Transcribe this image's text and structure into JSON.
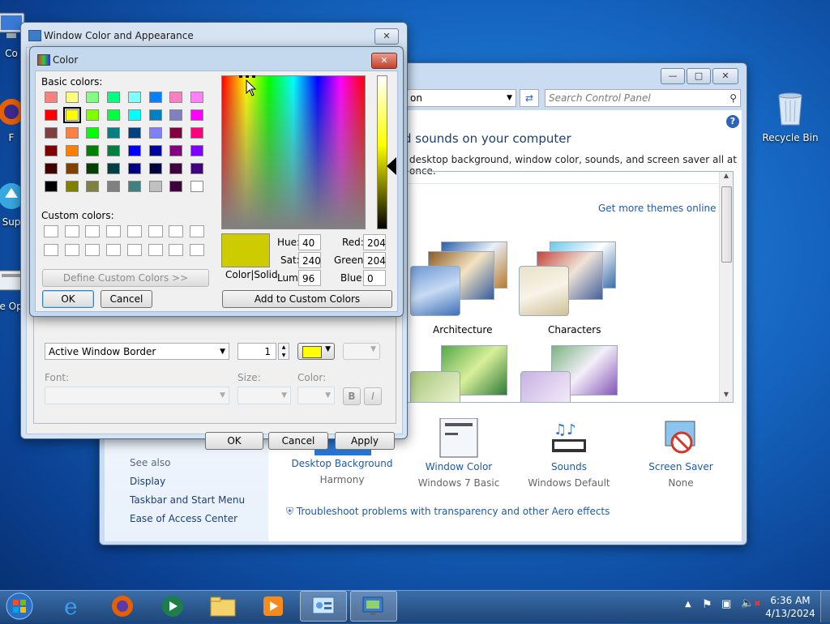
{
  "desktop": {
    "icons": [
      {
        "label": "Co",
        "icon": "computer-icon"
      },
      {
        "label": "F",
        "icon": "firefox-icon"
      },
      {
        "label": "Sup",
        "icon": "support-icon"
      },
      {
        "label": "Ke Opti",
        "icon": "keyboard-icon"
      },
      {
        "label": "Recycle Bin",
        "icon": "recycle-bin-icon"
      }
    ]
  },
  "control_panel": {
    "address_text": "on",
    "search_placeholder": "Search Control Panel",
    "heading": "d sounds on your computer",
    "subheading": "desktop background, window color, sounds, and screen saver all at once.",
    "get_more_themes": "Get more themes online",
    "themes": [
      {
        "name": "Architecture"
      },
      {
        "name": "Characters"
      }
    ],
    "bottom_items": [
      {
        "label": "Desktop Background",
        "value": "Harmony",
        "icon": "desktop-background-icon"
      },
      {
        "label": "Window Color",
        "value": "Windows 7 Basic",
        "icon": "window-color-icon"
      },
      {
        "label": "Sounds",
        "value": "Windows Default",
        "icon": "sounds-icon"
      },
      {
        "label": "Screen Saver",
        "value": "None",
        "icon": "screen-saver-icon"
      }
    ],
    "troubleshoot": "Troubleshoot problems with transparency and other Aero effects",
    "see_also": {
      "title": "See also",
      "links": [
        "Display",
        "Taskbar and Start Menu",
        "Ease of Access Center"
      ]
    }
  },
  "appearance_dialog": {
    "title": "Window Color and Appearance",
    "item_value": "Active Window Border",
    "size_value": "1",
    "color1": "#ffff00",
    "font_label": "Font:",
    "size_label": "Size:",
    "color_label": "Color:",
    "bold_label": "B",
    "italic_label": "I",
    "ok": "OK",
    "cancel": "Cancel",
    "apply": "Apply"
  },
  "color_dialog": {
    "title": "Color",
    "basic_colors_label": "Basic colors:",
    "custom_colors_label": "Custom colors:",
    "define_custom": "Define Custom Colors >>",
    "ok": "OK",
    "cancel": "Cancel",
    "add_custom": "Add to Custom Colors",
    "color_solid_label": "Color|Solid",
    "preview_color": "#cccc00",
    "hue_label": "Hue:",
    "sat_label": "Sat:",
    "lum_label": "Lum:",
    "red_label": "Red:",
    "green_label": "Green:",
    "blue_label": "Blue:",
    "hue": "40",
    "sat": "240",
    "lum": "96",
    "red": "204",
    "green": "204",
    "blue": "0",
    "basic_colors": [
      "#ff8080",
      "#ffff80",
      "#80ff80",
      "#00ff80",
      "#80ffff",
      "#0080ff",
      "#ff80c0",
      "#ff80ff",
      "#ff0000",
      "#ffff00",
      "#80ff00",
      "#00ff40",
      "#00ffff",
      "#0080c0",
      "#8080c0",
      "#ff00ff",
      "#804040",
      "#ff8040",
      "#00ff00",
      "#008080",
      "#004080",
      "#8080ff",
      "#800040",
      "#ff0080",
      "#800000",
      "#ff8000",
      "#008000",
      "#008040",
      "#0000ff",
      "#0000a0",
      "#800080",
      "#8000ff",
      "#400000",
      "#804000",
      "#004000",
      "#004040",
      "#000080",
      "#000040",
      "#400040",
      "#400080",
      "#000000",
      "#808000",
      "#808040",
      "#808080",
      "#408080",
      "#c0c0c0",
      "#400040",
      "#ffffff"
    ],
    "selected_basic_index": 9
  },
  "taskbar": {
    "time": "6:36 AM",
    "date": "4/13/2024",
    "apps": [
      "start-orb-icon",
      "internet-explorer-icon",
      "firefox-icon",
      "media-center-icon",
      "file-explorer-icon",
      "media-player-icon",
      "control-panel-icon",
      "appearance-icon"
    ]
  }
}
